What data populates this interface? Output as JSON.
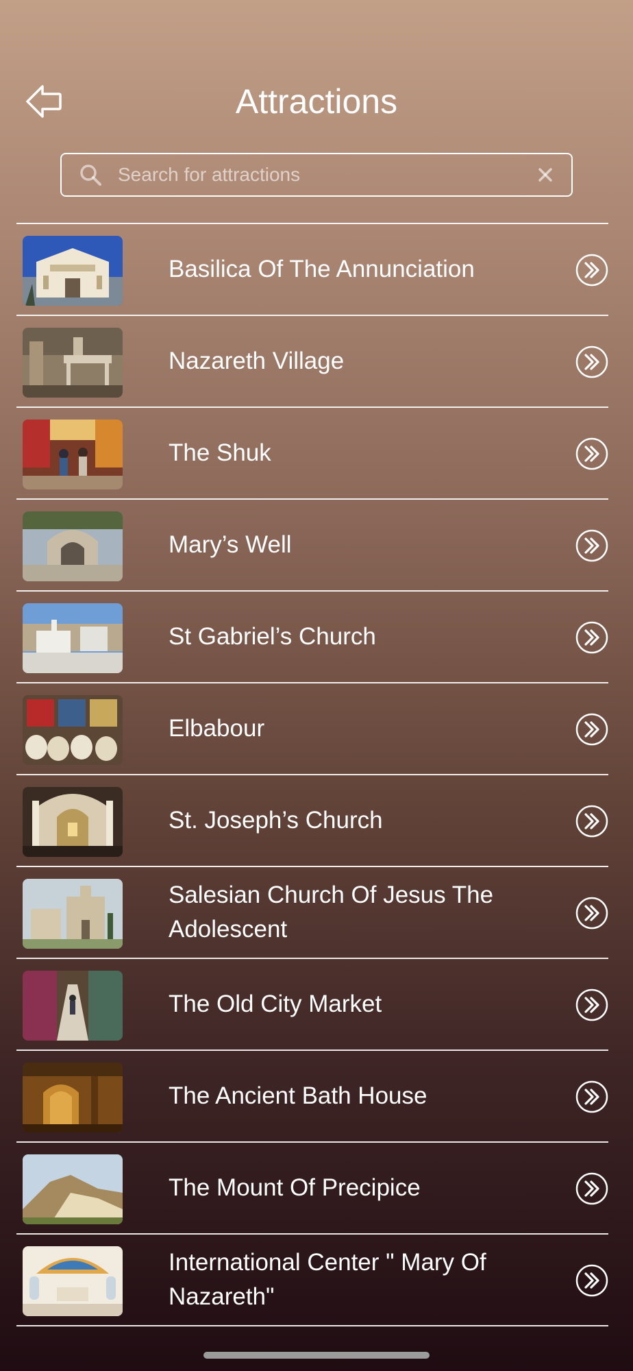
{
  "header": {
    "title": "Attractions",
    "back_icon": "back-arrow-icon"
  },
  "search": {
    "placeholder": "Search for attractions",
    "value": ""
  },
  "attractions": [
    {
      "label": "Basilica Of The Annunciation",
      "thumb": "basilica"
    },
    {
      "label": "Nazareth Village",
      "thumb": "village"
    },
    {
      "label": "The Shuk",
      "thumb": "shuk"
    },
    {
      "label": "Mary’s Well",
      "thumb": "well"
    },
    {
      "label": "St Gabriel’s Church",
      "thumb": "gabriel"
    },
    {
      "label": "Elbabour",
      "thumb": "elbabour"
    },
    {
      "label": "St. Joseph’s Church",
      "thumb": "joseph"
    },
    {
      "label": "Salesian Church Of Jesus The Adolescent",
      "thumb": "salesian"
    },
    {
      "label": "The Old City Market",
      "thumb": "market"
    },
    {
      "label": "The Ancient Bath House",
      "thumb": "bath"
    },
    {
      "label": "The Mount Of Precipice",
      "thumb": "precipice"
    },
    {
      "label": "International Center \" Mary Of Nazareth\"",
      "thumb": "center"
    }
  ],
  "colors": {
    "accent": "#ffffff",
    "gradient_top": "#c29f87",
    "gradient_bottom": "#1f0c12"
  }
}
